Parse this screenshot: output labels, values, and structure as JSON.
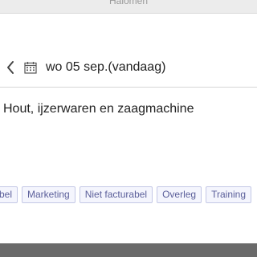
{
  "window": {
    "title": "Halomen"
  },
  "date_bar": {
    "date_label": "wo 05 sep.(vandaag)"
  },
  "entry": {
    "description": "Hout, ijzerwaren en zaagmachine"
  },
  "tags": [
    {
      "label": "bel"
    },
    {
      "label": "Marketing"
    },
    {
      "label": "Niet facturabel"
    },
    {
      "label": "Overleg"
    },
    {
      "label": "Training"
    }
  ],
  "icons": {
    "back": "chevron-left-icon",
    "calendar": "calendar-icon"
  },
  "colors": {
    "tag_border": "#c4c8e6",
    "tag_bg": "#f4f5fd",
    "tag_text": "#5b5f9a",
    "bottom_bar": "#6a6a6a"
  }
}
